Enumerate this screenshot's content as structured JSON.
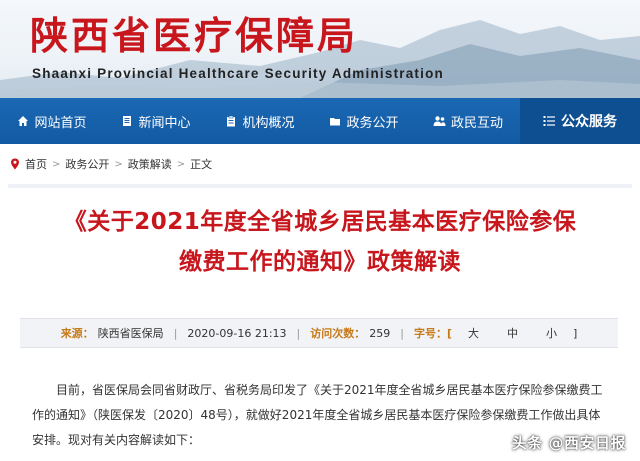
{
  "header": {
    "title": "陕西省医疗保障局",
    "subtitle": "Shaanxi Provincial Healthcare Security Administration"
  },
  "nav": {
    "items": [
      {
        "label": "网站首页",
        "icon": "home-icon"
      },
      {
        "label": "新闻中心",
        "icon": "document-icon"
      },
      {
        "label": "机构概况",
        "icon": "clipboard-icon"
      },
      {
        "label": "政务公开",
        "icon": "folder-icon"
      },
      {
        "label": "政民互动",
        "icon": "people-icon"
      },
      {
        "label": "公众服务",
        "icon": "list-icon",
        "active": true
      }
    ]
  },
  "breadcrumb": {
    "items": [
      "首页",
      "政务公开",
      "政策解读",
      "正文"
    ],
    "icon": "pin-icon"
  },
  "article": {
    "title_line1": "《关于2021年度全省城乡居民基本医疗保险参保",
    "title_line2": "缴费工作的通知》政策解读",
    "meta": {
      "source_label": "来源：",
      "source_value": "陕西省医保局",
      "date_value": "2020-09-16 21:13",
      "visits_label": "访问次数：",
      "visits_value": "259",
      "font_label": "字号：[",
      "font_large": "大",
      "font_medium": "中",
      "font_small": "小",
      "font_close": "]"
    },
    "body": "目前，省医保局会同省财政厅、省税务局印发了《关于2021年度全省城乡居民基本医疗保险参保缴费工作的通知》（陕医保发〔2020〕48号），就做好2021年度全省城乡居民基本医疗保险参保缴费工作做出具体安排。现对有关内容解读如下："
  },
  "watermark": "头条 @西安日报",
  "colors": {
    "title_red": "#c8161d",
    "nav_blue": "#1b68b4",
    "nav_active": "#0d4f91",
    "meta_label": "#c77b1a"
  }
}
